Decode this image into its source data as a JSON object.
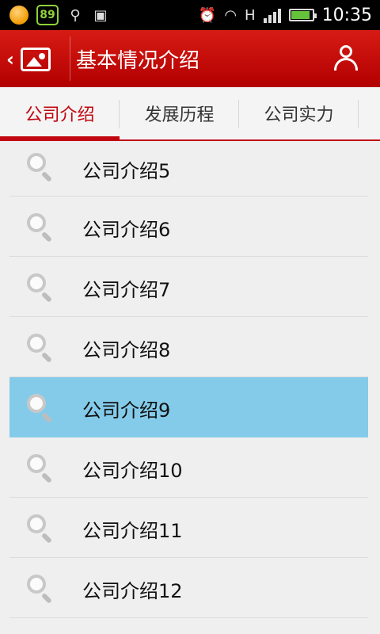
{
  "status": {
    "battery_badge": "89",
    "time": "10:35",
    "hplus": "H"
  },
  "header": {
    "title": "基本情况介绍"
  },
  "tabs": [
    {
      "label": "公司介绍",
      "active": true
    },
    {
      "label": "发展历程",
      "active": false
    },
    {
      "label": "公司实力",
      "active": false
    }
  ],
  "list": {
    "items": [
      {
        "label": "公司介绍5"
      },
      {
        "label": "公司介绍6"
      },
      {
        "label": "公司介绍7"
      },
      {
        "label": "公司介绍8"
      },
      {
        "label": "公司介绍9",
        "selected": true
      },
      {
        "label": "公司介绍10"
      },
      {
        "label": "公司介绍11"
      },
      {
        "label": "公司介绍12"
      }
    ]
  },
  "colors": {
    "header_red": "#c1060f",
    "selected_blue": "#84cbea",
    "list_bg": "#efefef"
  }
}
